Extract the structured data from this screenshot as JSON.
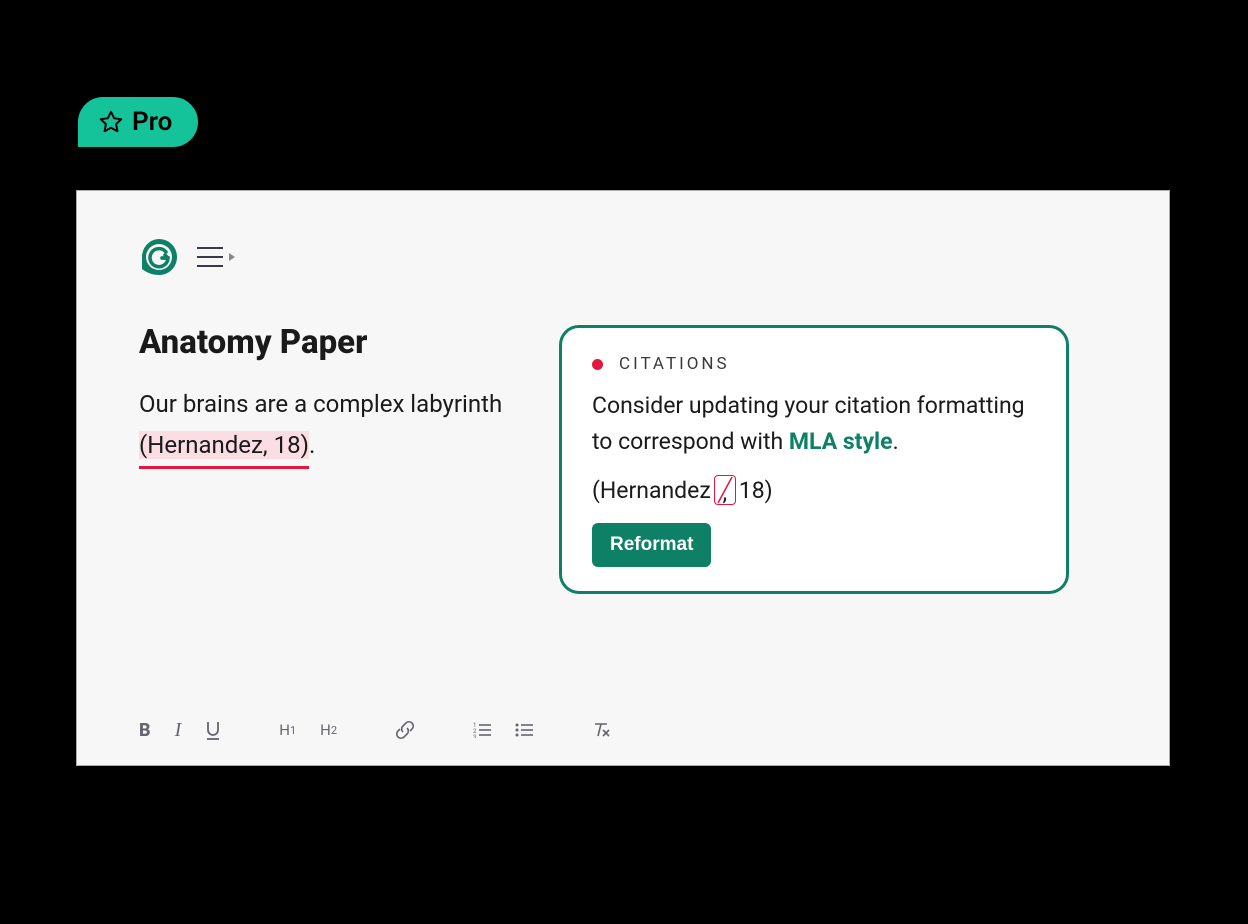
{
  "badge": {
    "label": "Pro"
  },
  "document": {
    "title": "Anatomy Paper",
    "text_before": "Our brains are a complex labyrinth ",
    "citation_text": "(Hernandez, 18)",
    "text_after": "."
  },
  "suggestion": {
    "category": "CITATIONS",
    "message_before": "Consider updating your citation formatting to correspond with ",
    "style_name": "MLA style",
    "message_after": ".",
    "preview_before": "(Hernandez",
    "preview_strike": ",",
    "preview_after": "18)",
    "action_label": "Reformat"
  },
  "toolbar": {
    "bold": "B",
    "italic": "I",
    "underline": "U",
    "h1": "H1",
    "h2": "H2"
  }
}
